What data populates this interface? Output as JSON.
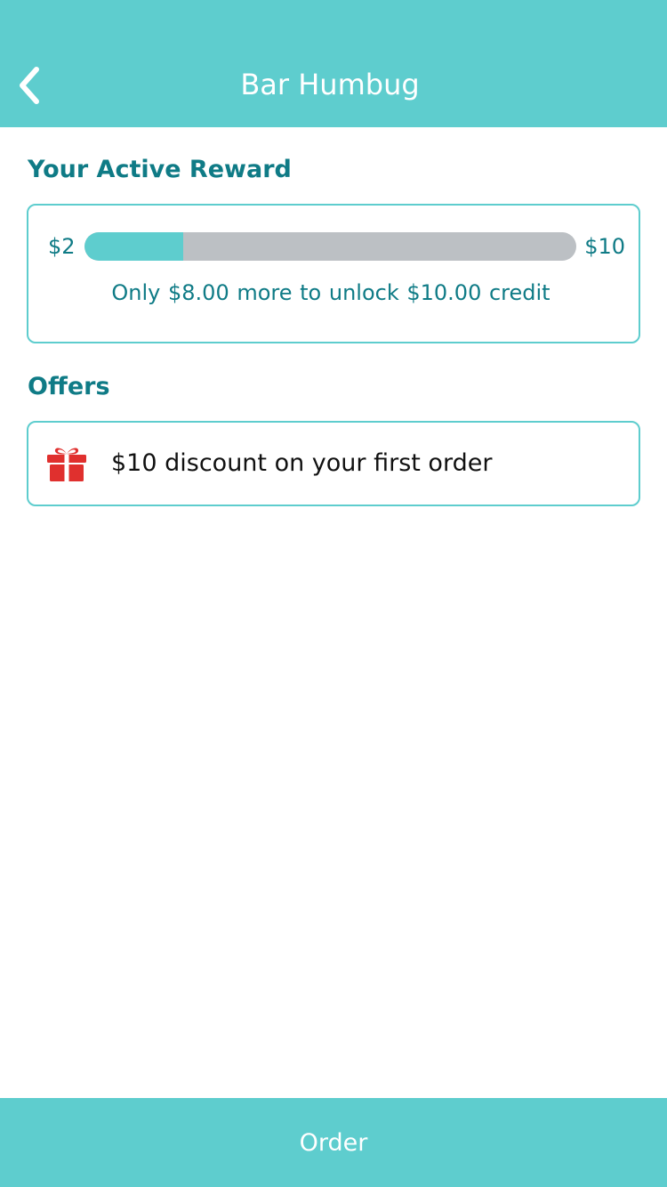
{
  "header": {
    "title": "Bar Humbug",
    "back_icon": "chevron-left-icon"
  },
  "reward": {
    "section_title": "Your Active Reward",
    "start_amount": "$2",
    "end_amount": "$10",
    "progress_fraction": 0.2,
    "message": "Only $8.00 more to unlock $10.00 credit"
  },
  "offers": {
    "section_title": "Offers",
    "items": [
      {
        "icon": "gift-icon",
        "text": "$10 discount on your first order"
      }
    ]
  },
  "footer": {
    "order_label": "Order"
  },
  "colors": {
    "accent": "#5ecdce",
    "text_teal": "#0f7b86",
    "progress_track": "#bcc0c4",
    "gift_red": "#e0302e"
  }
}
